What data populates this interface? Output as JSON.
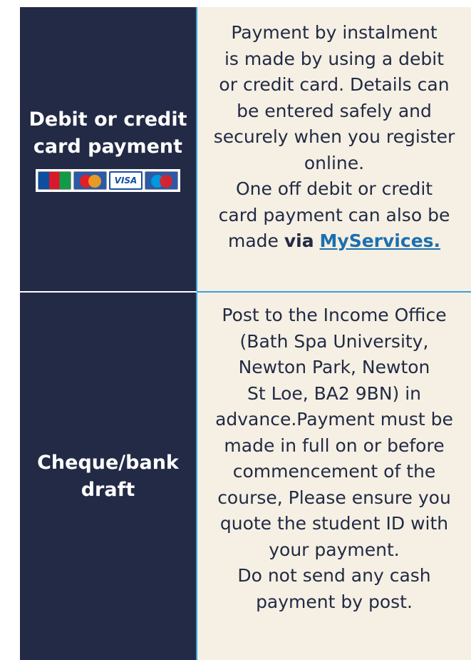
{
  "rows": [
    {
      "label_lines": [
        "Debit or credit",
        "card payment"
      ],
      "card_icons": [
        "jcb-card-icon",
        "mastercard-icon",
        "visa-card-icon",
        "maestro-card-icon"
      ],
      "visa_text": "VISA",
      "content_lines": [
        "Payment by instalment",
        "is made by using a debit",
        "or credit card. Details can",
        "be entered safely and",
        "securely when you register",
        "online.",
        "One off debit or credit",
        "card payment can also be"
      ],
      "last_line_prefix": "made ",
      "last_line_bold": "via",
      "link_text": "MyServices."
    },
    {
      "label_lines": [
        "Cheque/bank",
        "draft"
      ],
      "content_lines": [
        "Post to the Income Office",
        "(Bath Spa University,",
        "Newton Park, Newton",
        "St Loe, BA2 9BN) in",
        "advance.Payment must be",
        "made in full on or before",
        "commencement of the",
        "course, Please ensure you",
        "quote the student ID with",
        "your payment.",
        "Do not send any cash",
        "payment by post."
      ]
    }
  ],
  "colors": {
    "label_bg": "#222a45",
    "content_bg": "#f5f0e3",
    "accent": "#3aa0d8",
    "link": "#1c6fae"
  }
}
